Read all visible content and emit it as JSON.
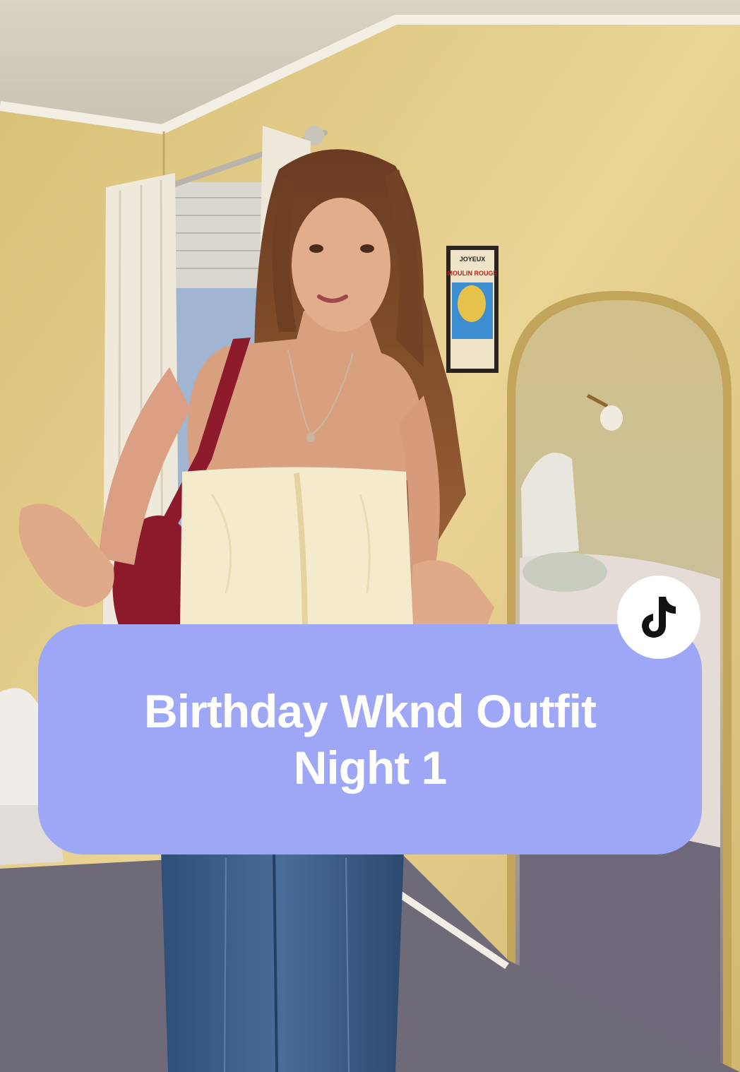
{
  "caption": {
    "line1": "Birthday Wknd Outfit",
    "line2": "Night 1"
  },
  "badge": {
    "icon": "tiktok-logo-icon"
  },
  "poster": {
    "text_top": "JOYEUX",
    "text_mid": "MOULIN ROUGE"
  },
  "colors": {
    "caption_bg": "#9ea7f6",
    "caption_text": "#ffffff",
    "wall": "#e6d08a",
    "carpet": "#6f6a78",
    "badge_bg": "#ffffff",
    "badge_icon": "#111111"
  }
}
